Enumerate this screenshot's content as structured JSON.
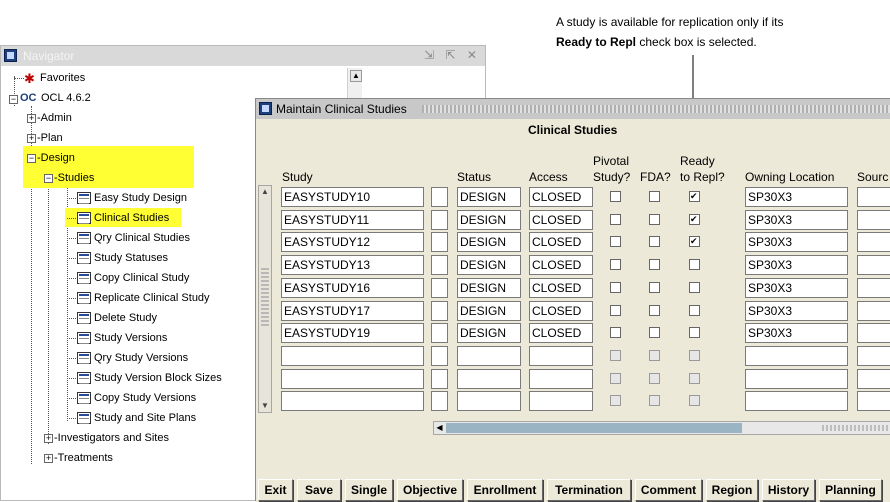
{
  "annotation": {
    "line1": "A study is available for replication only if its",
    "line2_bold": "Ready to Repl",
    "line2_rest": " check box is selected."
  },
  "navigator": {
    "title": "Navigator",
    "window_buttons": "⇲ ⇱ ✕",
    "tree": {
      "favorites": "Favorites",
      "ocl_label": "OC",
      "ocl_version": "OCL 4.6.2",
      "admin": "-Admin",
      "plan": "-Plan",
      "design": "-Design",
      "studies": "-Studies",
      "study_items": [
        "Easy Study Design",
        "Clinical Studies",
        "Qry Clinical Studies",
        "Study Statuses",
        "Copy Clinical Study",
        "Replicate Clinical Study",
        "Delete Study",
        "Study Versions",
        "Qry Study Versions",
        "Study Version Block Sizes",
        "Copy Study Versions",
        "Study and Site Plans"
      ],
      "investigators": "-Investigators and Sites",
      "treatments": "-Treatments"
    }
  },
  "maintain": {
    "title": "Maintain Clinical Studies",
    "heading": "Clinical Studies",
    "columns": {
      "study": "Study",
      "status": "Status",
      "access": "Access",
      "pivotal_1": "Pivotal",
      "pivotal_2": "Study?",
      "fda": "FDA?",
      "ready_1": "Ready",
      "ready_2": "to Repl?",
      "owning": "Owning Location",
      "source": "Sourc"
    },
    "rows": [
      {
        "study": "EASYSTUDY10",
        "status": "DESIGN",
        "access": "CLOSED",
        "pivotal": false,
        "fda": false,
        "ready": true,
        "owning": "SP30X3"
      },
      {
        "study": "EASYSTUDY11",
        "status": "DESIGN",
        "access": "CLOSED",
        "pivotal": false,
        "fda": false,
        "ready": true,
        "owning": "SP30X3"
      },
      {
        "study": "EASYSTUDY12",
        "status": "DESIGN",
        "access": "CLOSED",
        "pivotal": false,
        "fda": false,
        "ready": true,
        "owning": "SP30X3"
      },
      {
        "study": "EASYSTUDY13",
        "status": "DESIGN",
        "access": "CLOSED",
        "pivotal": false,
        "fda": false,
        "ready": false,
        "owning": "SP30X3"
      },
      {
        "study": "EASYSTUDY16",
        "status": "DESIGN",
        "access": "CLOSED",
        "pivotal": false,
        "fda": false,
        "ready": false,
        "owning": "SP30X3"
      },
      {
        "study": "EASYSTUDY17",
        "status": "DESIGN",
        "access": "CLOSED",
        "pivotal": false,
        "fda": false,
        "ready": false,
        "owning": "SP30X3"
      },
      {
        "study": "EASYSTUDY19",
        "status": "DESIGN",
        "access": "CLOSED",
        "pivotal": false,
        "fda": false,
        "ready": false,
        "owning": "SP30X3"
      },
      {
        "study": "",
        "status": "",
        "access": "",
        "pivotal": false,
        "fda": false,
        "ready": false,
        "owning": ""
      },
      {
        "study": "",
        "status": "",
        "access": "",
        "pivotal": false,
        "fda": false,
        "ready": false,
        "owning": ""
      },
      {
        "study": "",
        "status": "",
        "access": "",
        "pivotal": false,
        "fda": false,
        "ready": false,
        "owning": ""
      }
    ],
    "buttons": [
      "Exit",
      "Save",
      "Single",
      "Objective",
      "Enrollment",
      "Termination",
      "Comment",
      "Region",
      "History",
      "Planning"
    ]
  },
  "colors": {
    "highlight": "#ffff33",
    "window_bg": "#ece9d8"
  }
}
